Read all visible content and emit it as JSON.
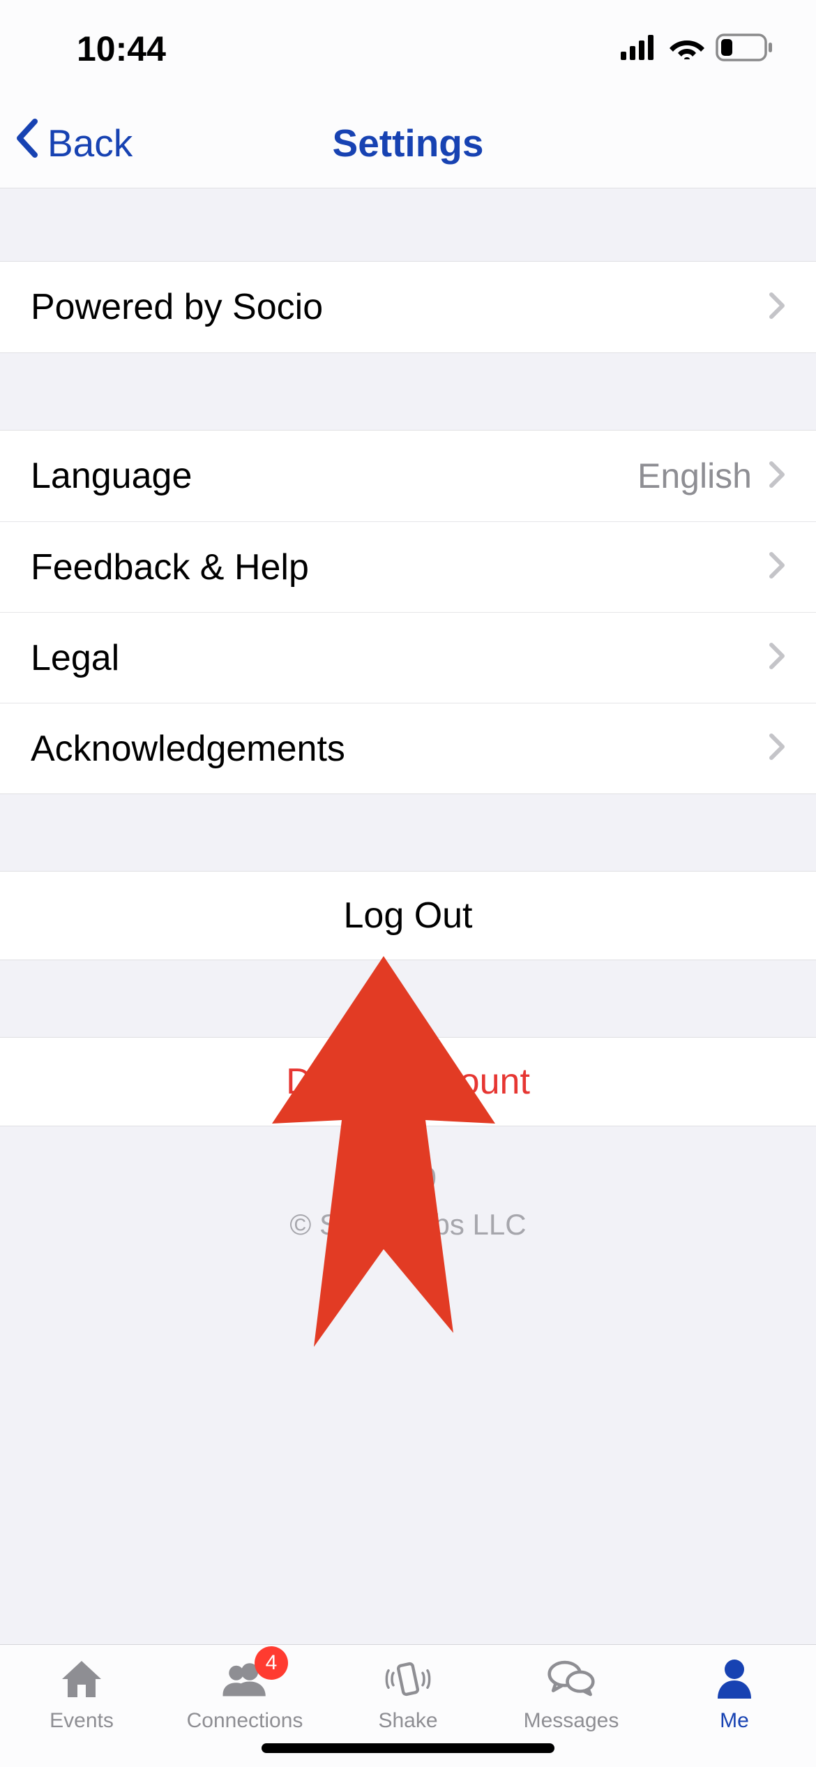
{
  "status": {
    "time": "10:44"
  },
  "nav": {
    "back_label": "Back",
    "title": "Settings"
  },
  "rows": {
    "powered_by": {
      "label": "Powered by Socio"
    },
    "language": {
      "label": "Language",
      "value": "English"
    },
    "feedback": {
      "label": "Feedback & Help"
    },
    "legal": {
      "label": "Legal"
    },
    "ack": {
      "label": "Acknowledgements"
    },
    "logout": {
      "label": "Log Out"
    },
    "delete": {
      "label": "Delete Account"
    }
  },
  "footer": {
    "version": "22.0",
    "copyright": "© Socio Labs LLC"
  },
  "tabs": {
    "events": {
      "label": "Events"
    },
    "connections": {
      "label": "Connections",
      "badge": "4"
    },
    "shake": {
      "label": "Shake"
    },
    "messages": {
      "label": "Messages"
    },
    "me": {
      "label": "Me"
    }
  },
  "colors": {
    "primary": "#1742b2",
    "danger": "#e63632",
    "annotation": "#e23b24"
  }
}
